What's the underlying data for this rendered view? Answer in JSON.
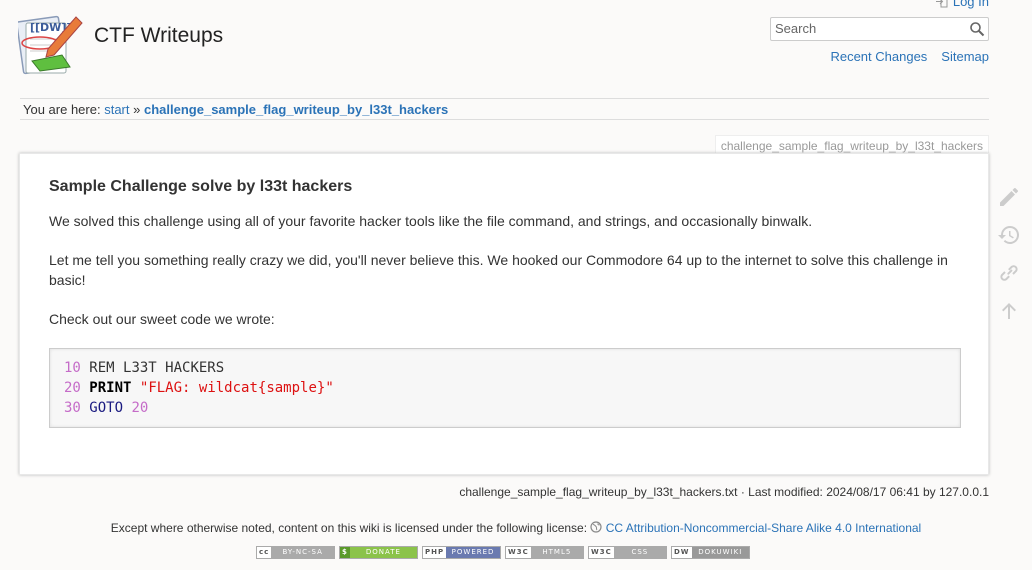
{
  "header": {
    "site_title": "CTF Writeups",
    "login_label": "Log In",
    "search_placeholder": "Search",
    "links": [
      "Recent Changes",
      "Sitemap"
    ]
  },
  "breadcrumb": {
    "prefix": "You are here:",
    "home": "start",
    "sep": "»",
    "current": "challenge_sample_flag_writeup_by_l33t_hackers"
  },
  "page": {
    "id": "challenge_sample_flag_writeup_by_l33t_hackers",
    "heading": "Sample Challenge solve by l33t hackers",
    "p1": "We solved this challenge using all of your favorite hacker tools like the file command, and strings, and occasionally binwalk.",
    "p2": "Let me tell you something really crazy we did, you'll never believe this. We hooked our Commodore 64 up to the internet to solve this challenge in basic!",
    "p3": "Check out our sweet code we wrote:",
    "code": {
      "l1_num": "10",
      "l1_rest": "REM L33T HACKERS",
      "l2_num": "20",
      "l2_kw": "PRINT",
      "l2_str": "\"FLAG: wildcat{sample}\"",
      "l3_num": "30",
      "l3_kw": "GOTO",
      "l3_arg": "20"
    }
  },
  "docinfo": "challenge_sample_flag_writeup_by_l33t_hackers.txt · Last modified: 2024/08/17 06:41 by 127.0.0.1",
  "license": {
    "text": "Except where otherwise noted, content on this wiki is licensed under the following license:",
    "link": "CC Attribution-Noncommercial-Share Alike 4.0 International"
  },
  "badges": [
    {
      "left": "cc",
      "right": "BY-NC-SA"
    },
    {
      "left": "$",
      "right": "DONATE"
    },
    {
      "left": "PHP",
      "right": "POWERED"
    },
    {
      "left": "W3C",
      "right": "HTML5"
    },
    {
      "left": "W3C",
      "right": "CSS"
    },
    {
      "left": "DW",
      "right": "DOKUWIKI"
    }
  ],
  "colors": {
    "link": "#2b73b7",
    "accent_green": "#4caf50",
    "accent_red": "#e45c3a"
  }
}
